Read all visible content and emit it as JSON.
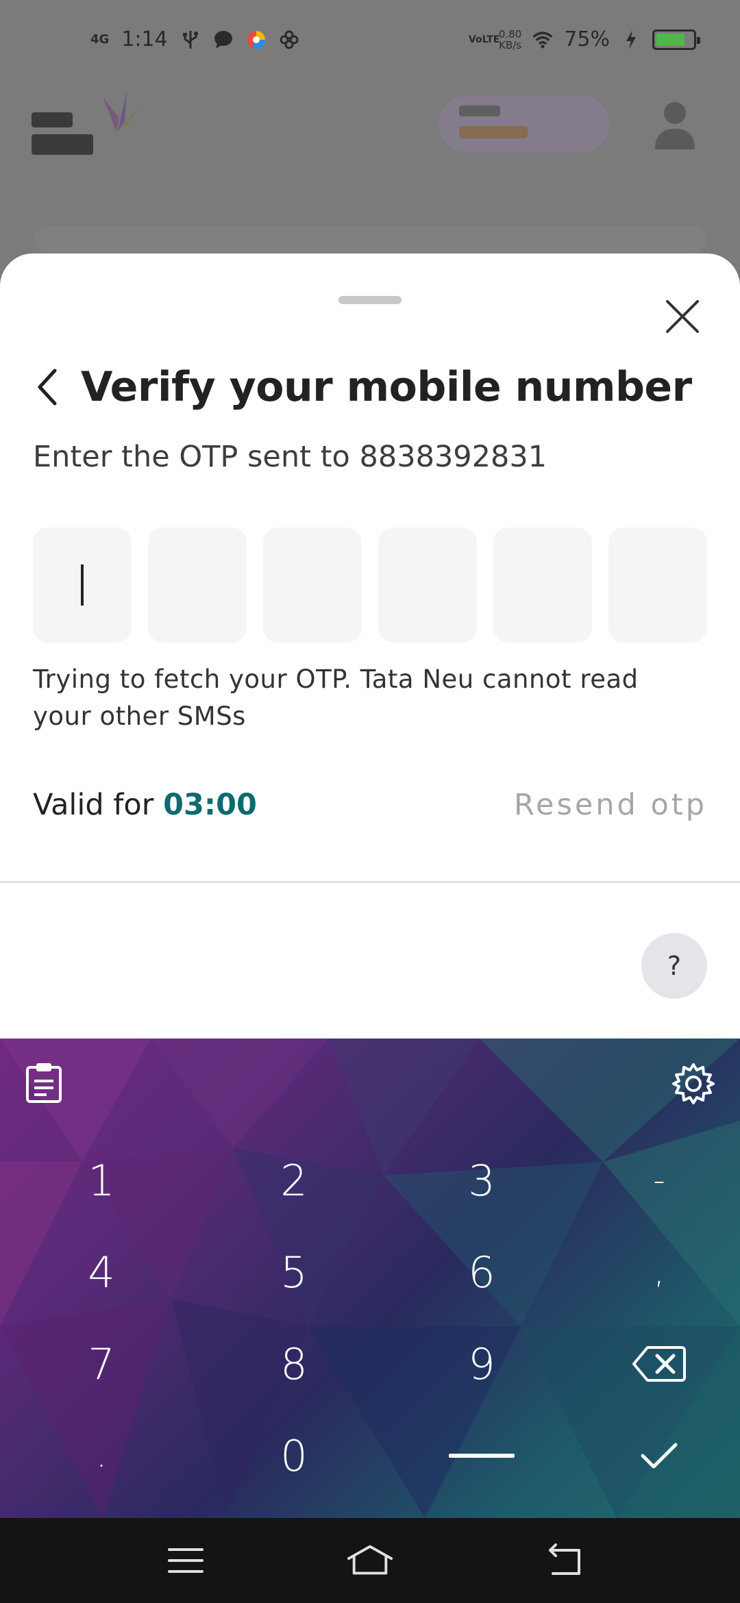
{
  "status_bar": {
    "network": "4G",
    "time": "1:14",
    "data_speed_value": "0.80",
    "data_speed_unit": "KB/s",
    "volte": "VoLTE",
    "battery": "75%"
  },
  "sheet": {
    "title": "Verify your mobile number",
    "subtitle": "Enter the OTP sent to 8838392831",
    "otp_digits": [
      "",
      "",
      "",
      "",
      "",
      ""
    ],
    "fetch_note": "Trying to fetch your OTP. Tata Neu cannot read your other SMSs",
    "valid_label": "Valid for",
    "valid_time": "03:00",
    "resend_label": "Resend otp",
    "help_label": "?"
  },
  "keyboard": {
    "keys": [
      "1",
      "2",
      "3",
      "-",
      "4",
      "5",
      "6",
      ",",
      "7",
      "8",
      "9",
      "⌫",
      ".",
      "0",
      "space",
      "✓"
    ]
  },
  "colors": {
    "accent_timer": "#0d6b6f",
    "resend_disabled": "#a6a6a6",
    "sheet_bg": "#ffffff",
    "otp_box_bg": "#f5f5f5"
  }
}
